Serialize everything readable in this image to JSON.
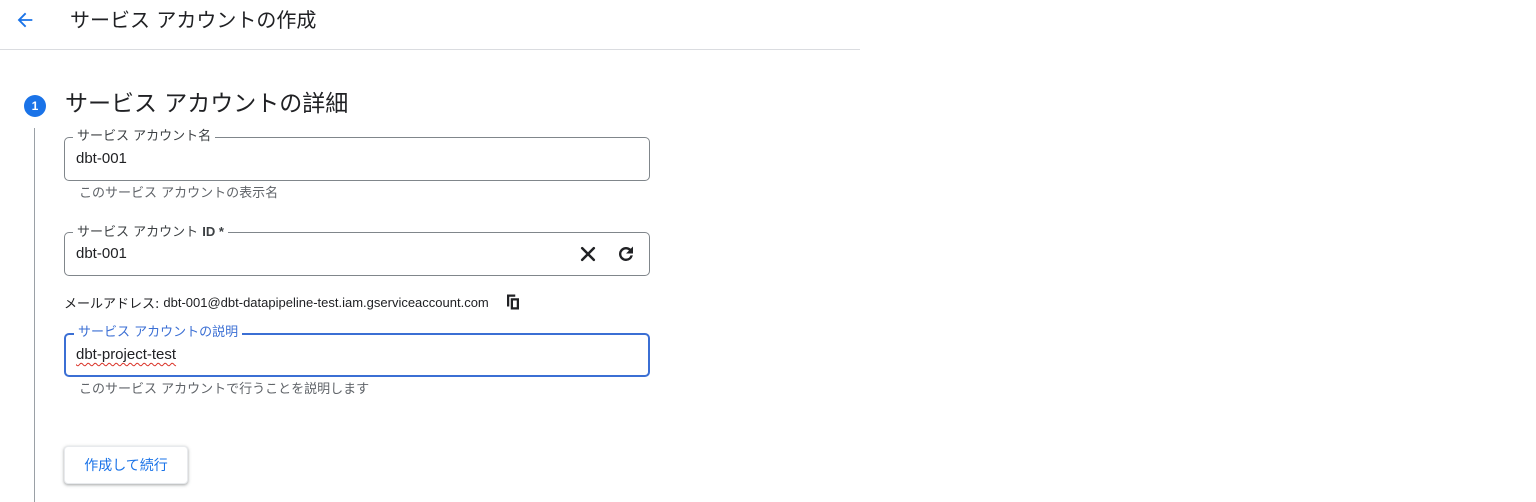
{
  "header": {
    "title": "サービス アカウントの作成",
    "back_icon": "arrow-left-icon"
  },
  "step": {
    "number": "1",
    "title": "サービス アカウントの詳細"
  },
  "fields": {
    "name": {
      "label": "サービス アカウント名",
      "value": "dbt-001",
      "hint": "このサービス アカウントの表示名"
    },
    "id": {
      "label": "サービス アカウント",
      "label_suffix": "ID *",
      "value": "dbt-001",
      "clear_icon": "close-icon",
      "refresh_icon": "refresh-icon"
    },
    "email": {
      "label": "メールアドレス:",
      "value": "dbt-001@dbt-datapipeline-test.iam.gserviceaccount.com",
      "copy_icon": "copy-icon"
    },
    "description": {
      "label": "サービス アカウントの説明",
      "value": "dbt-project-test",
      "hint": "このサービス アカウントで行うことを説明します"
    }
  },
  "actions": {
    "create_label": "作成して続行"
  },
  "colors": {
    "accent": "#1a73e8",
    "focus_border": "#3b6fd4",
    "text": "#202124",
    "secondary_text": "#5f6368",
    "border": "#80868b"
  }
}
